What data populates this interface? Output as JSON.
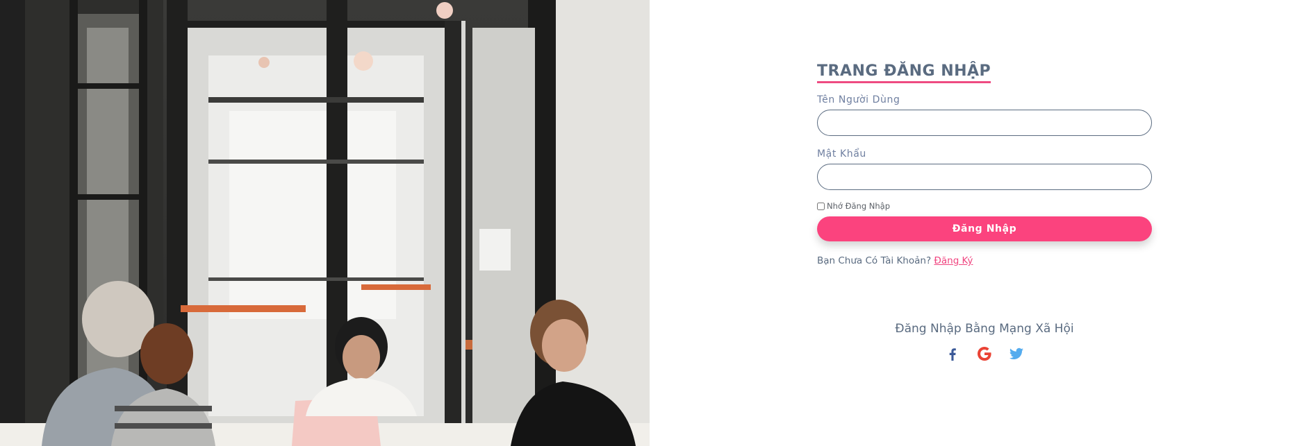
{
  "login": {
    "title": "TRANG ĐĂNG NHẬP",
    "username_label": "Tên Người Dùng",
    "username_value": "",
    "password_label": "Mật Khẩu",
    "password_value": "",
    "remember_label": "Nhớ Đăng Nhập",
    "remember_checked": false,
    "submit_label": "Đăng Nhập",
    "no_account_text": "Bạn Chưa Có Tài Khoản?",
    "signup_link": "Đăng Ký"
  },
  "social": {
    "title": "Đăng Nhập Bằng Mạng Xã Hội",
    "icons": [
      "facebook-icon",
      "google-icon",
      "twitter-icon"
    ]
  },
  "colors": {
    "accent": "#fb437e",
    "text": "#5a6b80",
    "facebook": "#3b5998",
    "google": "#ea4335",
    "twitter": "#55acee"
  }
}
